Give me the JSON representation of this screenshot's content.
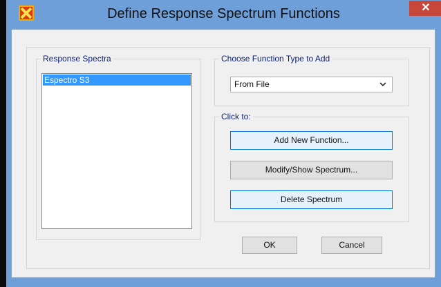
{
  "window": {
    "title": "Define Response Spectrum Functions",
    "close_label": "✕"
  },
  "response_spectra": {
    "legend": "Response Spectra",
    "items": [
      "Espectro S3"
    ],
    "selected": "Espectro S3"
  },
  "function_type": {
    "legend": "Choose  Function Type to Add",
    "selected": "From File"
  },
  "click_to": {
    "legend": "Click to:",
    "add_new_label": "Add New Function...",
    "modify_label": "Modify/Show Spectrum...",
    "delete_label": "Delete Spectrum"
  },
  "footer": {
    "ok_label": "OK",
    "cancel_label": "Cancel"
  },
  "colors": {
    "titlebar": "#6f9fd8",
    "close_button": "#c7483a",
    "selection": "#3399ff",
    "legend_text": "#0a1e7a"
  }
}
